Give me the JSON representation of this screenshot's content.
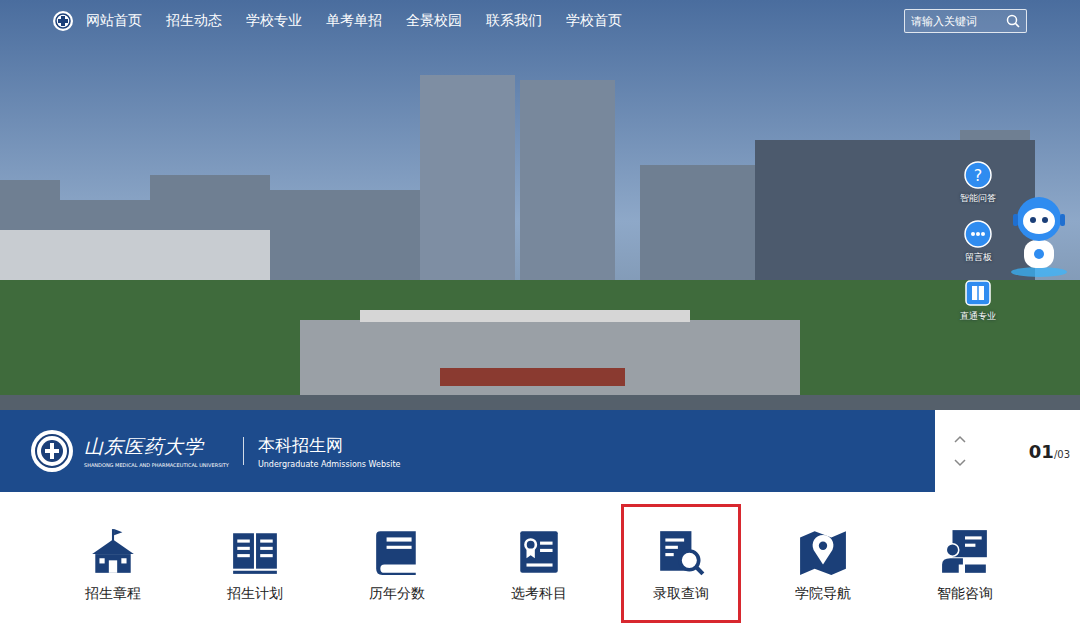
{
  "nav": {
    "items": [
      "网站首页",
      "招生动态",
      "学校专业",
      "单考单招",
      "全景校园",
      "联系我们",
      "学校首页"
    ],
    "search": {
      "placeholder": "请输入关键词"
    }
  },
  "side_tools": [
    {
      "label": "智能问答"
    },
    {
      "label": "留言板"
    },
    {
      "label": "直通专业"
    }
  ],
  "brand": {
    "name": "山东医药大学",
    "name_en": "SHANDONG MEDICAL AND PHARMACEUTICAL UNIVERSITY",
    "site": "本科招生网",
    "site_en": "Undergraduate Admissions Website"
  },
  "slider": {
    "current": "01",
    "total": "/03"
  },
  "quick_links": [
    {
      "label": "招生章程",
      "selected": false
    },
    {
      "label": "招生计划",
      "selected": false
    },
    {
      "label": "历年分数",
      "selected": false
    },
    {
      "label": "选考科目",
      "selected": false
    },
    {
      "label": "录取查询",
      "selected": true
    },
    {
      "label": "学院导航",
      "selected": false
    },
    {
      "label": "智能咨询",
      "selected": false
    }
  ]
}
